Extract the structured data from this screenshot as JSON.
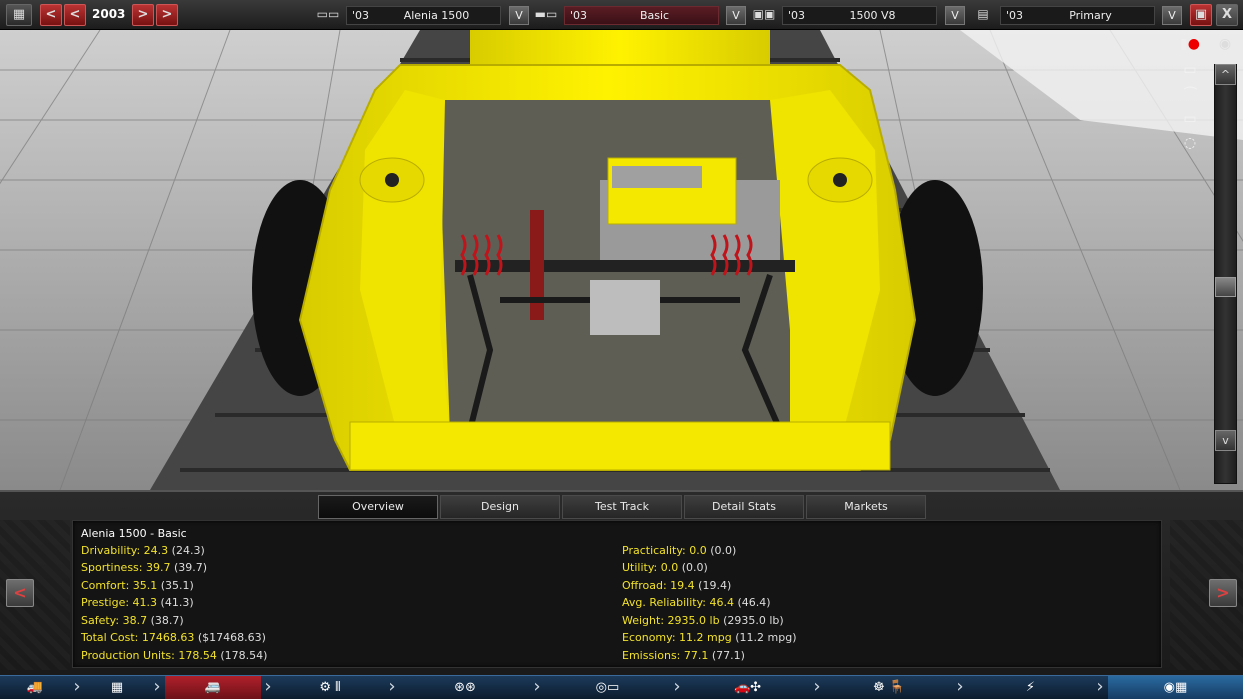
{
  "topbar": {
    "year": "2003",
    "prev_label": "<",
    "prev2_label": "<",
    "next_label": ">",
    "next2_label": ">",
    "selectors": [
      {
        "icon": "car-body-icon",
        "year": "'03",
        "name": "Alenia 1500",
        "dropdown": "V"
      },
      {
        "icon": "trim-car-icon",
        "year": "'03",
        "name": "Basic",
        "dropdown": "V"
      },
      {
        "icon": "engine-icon",
        "year": "'03",
        "name": "1500 V8",
        "dropdown": "V"
      },
      {
        "icon": "paint-icon",
        "year": "'03",
        "name": "Primary",
        "dropdown": "V"
      }
    ],
    "close_label": "X"
  },
  "viewport": {
    "scroll_up": "^",
    "scroll_down": "v"
  },
  "tabs": [
    "Overview",
    "Design",
    "Test Track",
    "Detail Stats",
    "Markets"
  ],
  "active_tab": "Overview",
  "panel": {
    "title": "Alenia 1500 - Basic",
    "prev_label": "<",
    "next_label": ">",
    "left_stats": [
      {
        "key": "Drivability: 24.3",
        "paren": "(24.3)"
      },
      {
        "key": "Sportiness: 39.7",
        "paren": "(39.7)"
      },
      {
        "key": "Comfort: 35.1",
        "paren": "(35.1)"
      },
      {
        "key": "Prestige: 41.3",
        "paren": "(41.3)"
      },
      {
        "key": "Safety: 38.7",
        "paren": "(38.7)"
      },
      {
        "key": "Total Cost: 17468.63",
        "paren": "($17468.63)"
      },
      {
        "key": "Production Units: 178.54",
        "paren": "(178.54)"
      }
    ],
    "right_stats": [
      {
        "key": "Practicality: 0.0",
        "paren": "(0.0)"
      },
      {
        "key": "Utility: 0.0",
        "paren": "(0.0)"
      },
      {
        "key": "Offroad: 19.4",
        "paren": "(19.4)"
      },
      {
        "key": "Avg. Reliability: 46.4",
        "paren": "(46.4)"
      },
      {
        "key": "Weight: 2935.0 lb",
        "paren": "(2935.0 lb)"
      },
      {
        "key": "Economy: 11.2 mpg",
        "paren": "(11.2 mpg)"
      },
      {
        "key": "Emissions: 77.1",
        "paren": "(77.1)"
      }
    ]
  },
  "stages": [
    {
      "icon": "chassis-truck-icon",
      "glyph": "🚚"
    },
    {
      "icon": "frame-icon",
      "glyph": "▦"
    },
    {
      "icon": "body-icon",
      "glyph": "🚐"
    },
    {
      "icon": "engine-cylinders-icon",
      "glyph": "⚙ ⫴"
    },
    {
      "icon": "wheels-icon",
      "glyph": "⊛⊛"
    },
    {
      "icon": "brakes-icon",
      "glyph": "◎▭"
    },
    {
      "icon": "car-fan-icon",
      "glyph": "🚗✣"
    },
    {
      "icon": "steering-seat-icon",
      "glyph": "☸ 🪑"
    },
    {
      "icon": "suspension-icon",
      "glyph": "⚡"
    },
    {
      "icon": "finish-flag-icon",
      "glyph": "◉▦"
    }
  ],
  "colors": {
    "stat_key": "#f2e22a",
    "body_yellow": "#f4e800",
    "active_stage": "#b0202a",
    "stage_bar": "#1c3a5a"
  }
}
